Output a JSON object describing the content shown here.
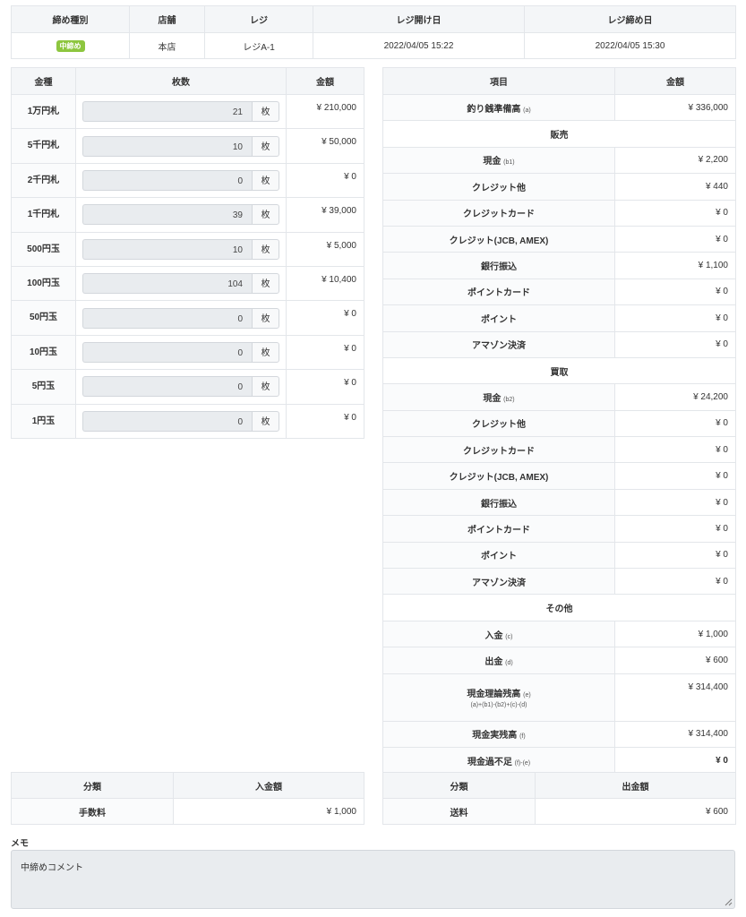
{
  "summary": {
    "headers": [
      "締め種別",
      "店舗",
      "レジ",
      "レジ開け日",
      "レジ締め日"
    ],
    "type_badge": "中締め",
    "badge_color": "#8dc63f",
    "store": "本店",
    "register": "レジA-1",
    "opened": "2022/04/05 15:22",
    "closed": "2022/04/05 15:30"
  },
  "denoms": {
    "headers": [
      "金種",
      "枚数",
      "金額"
    ],
    "unit": "枚",
    "rows": [
      {
        "label": "1万円札",
        "count": "21",
        "amount": "¥ 210,000"
      },
      {
        "label": "5千円札",
        "count": "10",
        "amount": "¥ 50,000"
      },
      {
        "label": "2千円札",
        "count": "0",
        "amount": "¥ 0"
      },
      {
        "label": "1千円札",
        "count": "39",
        "amount": "¥ 39,000"
      },
      {
        "label": "500円玉",
        "count": "10",
        "amount": "¥ 5,000"
      },
      {
        "label": "100円玉",
        "count": "104",
        "amount": "¥ 10,400"
      },
      {
        "label": "50円玉",
        "count": "0",
        "amount": "¥ 0"
      },
      {
        "label": "10円玉",
        "count": "0",
        "amount": "¥ 0"
      },
      {
        "label": "5円玉",
        "count": "0",
        "amount": "¥ 0"
      },
      {
        "label": "1円玉",
        "count": "0",
        "amount": "¥ 0"
      }
    ]
  },
  "items": {
    "headers": [
      "項目",
      "金額"
    ],
    "float": {
      "label": "釣り銭準備高",
      "sub": "(a)",
      "value": "¥ 336,000"
    },
    "sales_title": "販売",
    "sales": [
      {
        "label": "現金",
        "sub": "(b1)",
        "value": "¥ 2,200"
      },
      {
        "label": "クレジット他",
        "sub": "",
        "value": "¥ 440"
      },
      {
        "label": "クレジットカード",
        "sub": "",
        "value": "¥ 0"
      },
      {
        "label": "クレジット(JCB, AMEX)",
        "sub": "",
        "value": "¥ 0"
      },
      {
        "label": "銀行振込",
        "sub": "",
        "value": "¥ 1,100"
      },
      {
        "label": "ポイントカード",
        "sub": "",
        "value": "¥ 0"
      },
      {
        "label": "ポイント",
        "sub": "",
        "value": "¥ 0"
      },
      {
        "label": "アマゾン決済",
        "sub": "",
        "value": "¥ 0"
      }
    ],
    "buy_title": "買取",
    "buy": [
      {
        "label": "現金",
        "sub": "(b2)",
        "value": "¥ 24,200"
      },
      {
        "label": "クレジット他",
        "sub": "",
        "value": "¥ 0"
      },
      {
        "label": "クレジットカード",
        "sub": "",
        "value": "¥ 0"
      },
      {
        "label": "クレジット(JCB, AMEX)",
        "sub": "",
        "value": "¥ 0"
      },
      {
        "label": "銀行振込",
        "sub": "",
        "value": "¥ 0"
      },
      {
        "label": "ポイントカード",
        "sub": "",
        "value": "¥ 0"
      },
      {
        "label": "ポイント",
        "sub": "",
        "value": "¥ 0"
      },
      {
        "label": "アマゾン決済",
        "sub": "",
        "value": "¥ 0"
      }
    ],
    "other_title": "その他",
    "deposit": {
      "label": "入金",
      "sub": "(c)",
      "value": "¥ 1,000"
    },
    "withdraw": {
      "label": "出金",
      "sub": "(d)",
      "value": "¥ 600"
    },
    "theory": {
      "label": "現金理論残高",
      "sub": "(e)",
      "formula": "(a)+(b1)-(b2)+(c)-(d)",
      "value": "¥ 314,400"
    },
    "actual": {
      "label": "現金実残高",
      "sub": "(f)",
      "value": "¥ 314,400"
    },
    "diff": {
      "label": "現金過不足",
      "sub": "(f)-(e)",
      "value": "¥ 0"
    }
  },
  "deposits": {
    "headers": [
      "分類",
      "入金額"
    ],
    "rows": [
      {
        "category": "手数料",
        "amount": "¥ 1,000"
      }
    ]
  },
  "payouts": {
    "headers": [
      "分類",
      "出金額"
    ],
    "rows": [
      {
        "category": "送料",
        "amount": "¥ 600"
      }
    ]
  },
  "memo": {
    "label": "メモ",
    "value": "中締めコメント"
  }
}
